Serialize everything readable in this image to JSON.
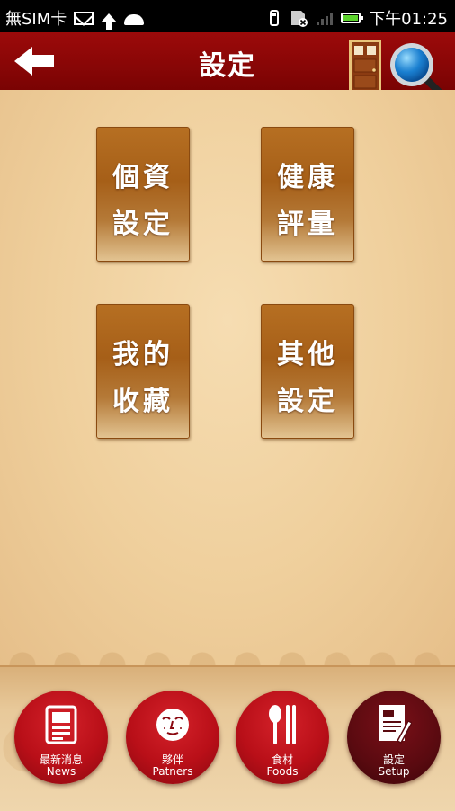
{
  "status_bar": {
    "sim_text": "無SIM卡",
    "time": "下午01:25",
    "icons": [
      "gmail-icon",
      "upload-icon",
      "android-icon",
      "usb-icon",
      "sd-card-icon",
      "signal-icon",
      "battery-icon"
    ],
    "battery_color": "#5bd22c"
  },
  "header": {
    "title": "設定",
    "back_icon": "back-arrow-icon",
    "door_icon": "door-icon",
    "search_icon": "magnifier-icon",
    "bar_color": "#8a0606"
  },
  "menu": [
    {
      "line1": "個資",
      "line2": "設定"
    },
    {
      "line1": "健康",
      "line2": "評量"
    },
    {
      "line1": "我的",
      "line2": "收藏"
    },
    {
      "line1": "其他",
      "line2": "設定"
    }
  ],
  "tabs": [
    {
      "zh": "最新消息",
      "en": "News",
      "icon": "newspaper-icon",
      "active": false
    },
    {
      "zh": "夥伴",
      "en": "Patners",
      "icon": "face-icon",
      "active": false
    },
    {
      "zh": "食材",
      "en": "Foods",
      "icon": "spoon-chopsticks-icon",
      "active": false
    },
    {
      "zh": "設定",
      "en": "Setup",
      "icon": "document-edit-icon",
      "active": true
    }
  ],
  "colors": {
    "tab_red": "#b90f18",
    "tab_active": "#5a0a10",
    "button_brown": "#a65f18",
    "background_cream": "#f6ddb2"
  }
}
